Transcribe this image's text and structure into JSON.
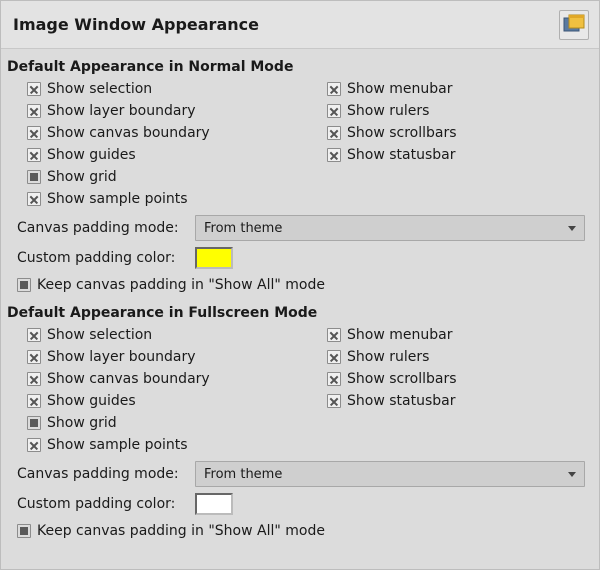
{
  "header": {
    "title": "Image Window Appearance",
    "icon": "appearance-icon"
  },
  "sections": {
    "normal": {
      "title": "Default Appearance in Normal Mode",
      "options_left": [
        {
          "label": "Show selection",
          "checked": true,
          "filled": false
        },
        {
          "label": "Show layer boundary",
          "checked": true,
          "filled": false
        },
        {
          "label": "Show canvas boundary",
          "checked": true,
          "filled": false
        },
        {
          "label": "Show guides",
          "checked": true,
          "filled": false
        },
        {
          "label": "Show grid",
          "checked": false,
          "filled": true
        },
        {
          "label": "Show sample points",
          "checked": true,
          "filled": false
        }
      ],
      "options_right": [
        {
          "label": "Show menubar",
          "checked": true,
          "filled": false
        },
        {
          "label": "Show rulers",
          "checked": true,
          "filled": false
        },
        {
          "label": "Show scrollbars",
          "checked": true,
          "filled": false
        },
        {
          "label": "Show statusbar",
          "checked": true,
          "filled": false
        }
      ],
      "padding_mode_label": "Canvas padding mode:",
      "padding_mode_value": "From theme",
      "custom_color_label": "Custom padding color:",
      "custom_color": "#ffff00",
      "keep_padding_label": "Keep canvas padding in \"Show All\" mode",
      "keep_padding_checked": false
    },
    "fullscreen": {
      "title": "Default Appearance in Fullscreen Mode",
      "options_left": [
        {
          "label": "Show selection",
          "checked": true,
          "filled": false
        },
        {
          "label": "Show layer boundary",
          "checked": true,
          "filled": false
        },
        {
          "label": "Show canvas boundary",
          "checked": true,
          "filled": false
        },
        {
          "label": "Show guides",
          "checked": true,
          "filled": false
        },
        {
          "label": "Show grid",
          "checked": false,
          "filled": true
        },
        {
          "label": "Show sample points",
          "checked": true,
          "filled": false
        }
      ],
      "options_right": [
        {
          "label": "Show menubar",
          "checked": true,
          "filled": false
        },
        {
          "label": "Show rulers",
          "checked": true,
          "filled": false
        },
        {
          "label": "Show scrollbars",
          "checked": true,
          "filled": false
        },
        {
          "label": "Show statusbar",
          "checked": true,
          "filled": false
        }
      ],
      "padding_mode_label": "Canvas padding mode:",
      "padding_mode_value": "From theme",
      "custom_color_label": "Custom padding color:",
      "custom_color": "#ffffff",
      "keep_padding_label": "Keep canvas padding in \"Show All\" mode",
      "keep_padding_checked": false
    }
  }
}
